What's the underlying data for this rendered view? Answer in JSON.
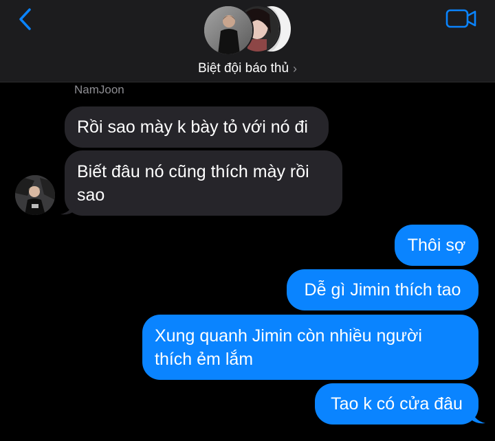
{
  "header": {
    "back_icon": "chevron-left-icon",
    "video_icon": "video-camera-icon",
    "group_title": "Biệt đội báo thủ",
    "title_chevron": "›"
  },
  "colors": {
    "accent": "#0a84ff",
    "incoming_bubble": "#26252a",
    "header_bg": "#1c1c1e",
    "background": "#000000",
    "secondary_text": "#8e8e93"
  },
  "messages": {
    "sender_name": "NamJoon",
    "incoming": [
      {
        "text": "Rồi sao mày k bày tỏ với nó đi"
      },
      {
        "line1": "Biết đâu nó cũng thích mày rồi",
        "line2": "sao"
      }
    ],
    "outgoing": [
      {
        "text": "Thôi sợ"
      },
      {
        "text": "Dễ gì Jimin thích tao"
      },
      {
        "line1": "Xung quanh Jimin còn nhiều người",
        "line2": "thích ẻm lắm"
      },
      {
        "text": "Tao k có cửa đâu"
      }
    ]
  }
}
